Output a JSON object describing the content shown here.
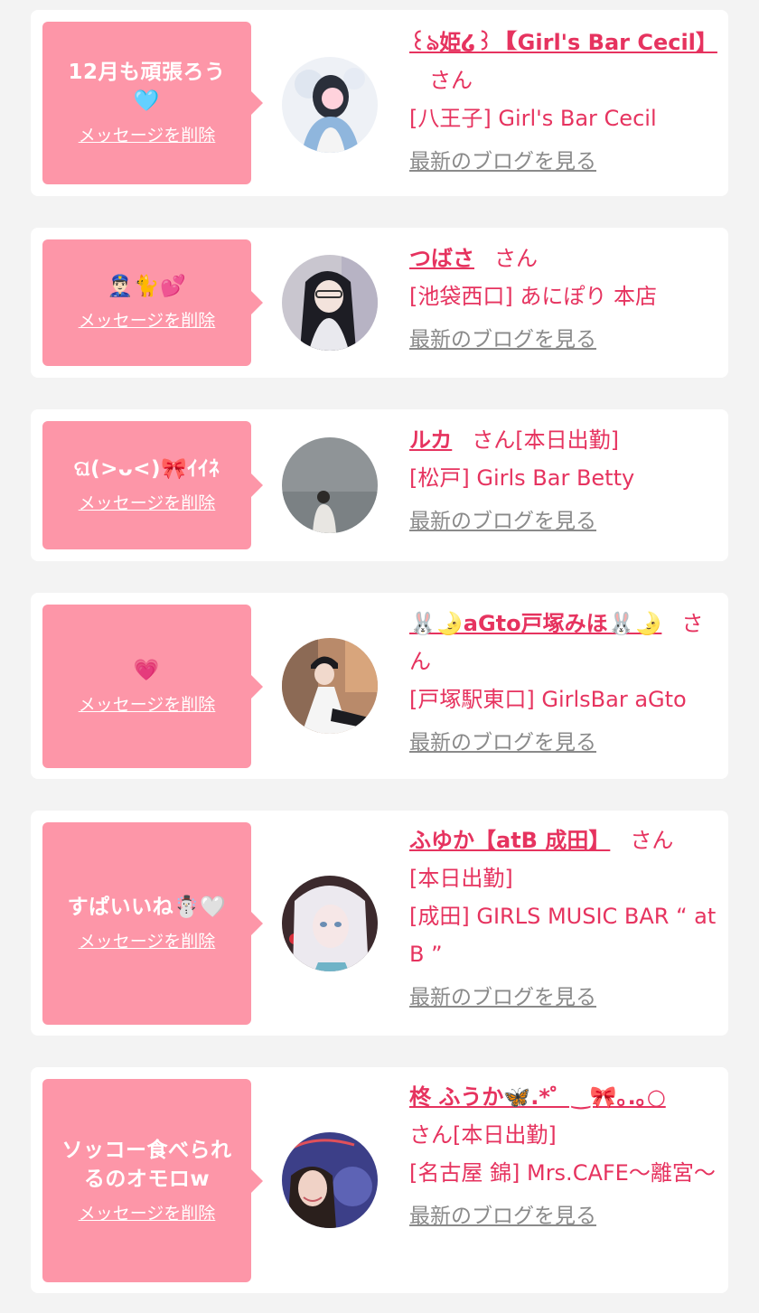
{
  "delete_label": "メッセージを削除",
  "blog_label": "最新のブログを見る",
  "san_label": "さん",
  "cards": [
    {
      "message": "12月も頑張ろう\n🩵",
      "name": "꒰ঌ姫໒꒱ 【Girl's Bar Cecil】",
      "suffix": "",
      "area": "[八王子] Girl's Bar Cecil"
    },
    {
      "message": "👮🏻‍♂️🐈💕",
      "name": "つばさ",
      "suffix": "",
      "area": "[池袋西口] あにぽり 本店"
    },
    {
      "message": "ଘ(>ᴗ<)🎀ｲｲﾈ",
      "name": "ルカ",
      "suffix": "[本日出勤]",
      "area": "[松戸] Girls Bar Betty"
    },
    {
      "message": "💗",
      "name": "🐰🌛aGto戸塚みほ🐰🌛",
      "suffix": "",
      "area": "[戸塚駅東口] GirlsBar aGto"
    },
    {
      "message": "すぱいいね☃️🤍",
      "name": "ふゆか【atB 成田】",
      "suffix": "[本日出勤]",
      "area": "[成田] GIRLS MUSIC BAR “ at B ”"
    },
    {
      "message": "ソッコー食べられ\nるのオモロw",
      "name": "柊 ふうか🦋.*゜‿🎀｡.｡○",
      "suffix": "[本日出勤]",
      "area": "[名古屋 錦] Mrs.CAFE〜離宮〜"
    }
  ],
  "colors": {
    "accent": "#e6335f",
    "bubble": "#fd96a8",
    "link_gray": "#8a8a8a",
    "background": "#f3f3f3"
  }
}
